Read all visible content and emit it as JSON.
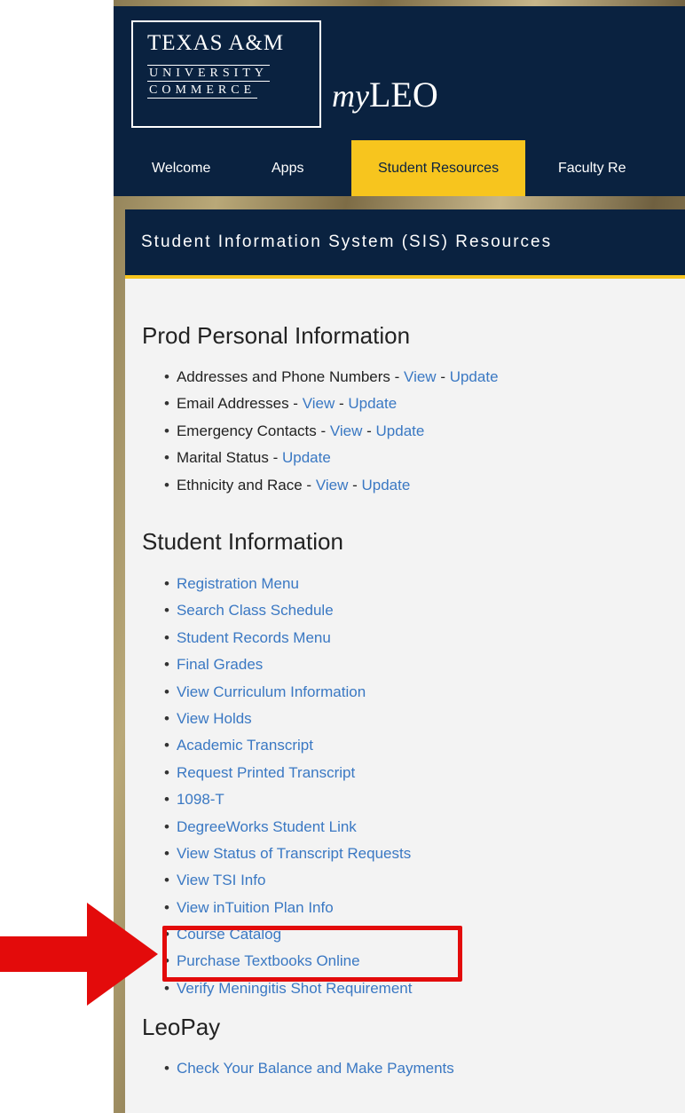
{
  "logo": {
    "line1": "TEXAS A&M",
    "line2": "UNIVERSITY",
    "line3": "COMMERCE"
  },
  "brand": {
    "my": "my",
    "leo": "LEO"
  },
  "nav": [
    {
      "label": "Welcome",
      "active": false
    },
    {
      "label": "Apps",
      "active": false
    },
    {
      "label": "Student Resources",
      "active": true
    },
    {
      "label": "Faculty Re",
      "active": false
    }
  ],
  "panel_title": "Student Information System (SIS) Resources",
  "sections": [
    {
      "title": "Prod Personal Information",
      "items": [
        {
          "label": "Addresses and Phone Numbers - ",
          "links": [
            "View",
            "Update"
          ]
        },
        {
          "label": "Email Addresses - ",
          "links": [
            "View",
            "Update"
          ]
        },
        {
          "label": "Emergency Contacts - ",
          "links": [
            "View",
            "Update"
          ]
        },
        {
          "label": "Marital Status - ",
          "links": [
            "Update"
          ]
        },
        {
          "label": "Ethnicity and Race - ",
          "links": [
            "View",
            "Update"
          ]
        }
      ]
    },
    {
      "title": "Student Information",
      "items": [
        "Registration Menu",
        "Search Class Schedule",
        "Student Records Menu",
        "Final Grades",
        "View Curriculum Information",
        "View Holds",
        "Academic Transcript",
        "Request Printed Transcript",
        "1098-T",
        "DegreeWorks Student Link",
        "View Status of Transcript Requests",
        "View TSI Info",
        "View inTuition Plan Info",
        "Course Catalog",
        "Purchase Textbooks Online",
        "Verify Meningitis Shot Requirement"
      ]
    },
    {
      "title": "LeoPay",
      "items": [
        "Check Your Balance and Make Payments"
      ]
    }
  ],
  "separator": " - ",
  "colors": {
    "navy": "#0a2240",
    "gold": "#f7c51e",
    "link": "#3a78c3",
    "annotation": "#e30b0b"
  },
  "annotation": {
    "highlighted_item": "Purchase Textbooks Online",
    "icon": "arrow-right-icon"
  }
}
